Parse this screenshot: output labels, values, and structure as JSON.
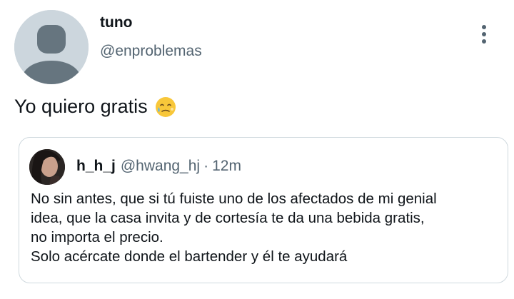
{
  "tweet": {
    "display_name": "tuno",
    "handle": "@enproblemas",
    "text": "Yo quiero gratis",
    "emoji": "face-holding-back-tears"
  },
  "quoted_tweet": {
    "display_name": "h_h_j",
    "handle": "@hwang_hj",
    "separator": "·",
    "time": "12m",
    "lines": [
      "No sin antes, que si tú fuiste uno de los afectados de mi genial",
      "idea, que la casa invita y de cortesía te da una bebida gratis,",
      "no importa el precio.",
      "Solo acércate donde el bartender y él te ayudará"
    ]
  },
  "colors": {
    "text_primary": "#0f1419",
    "text_secondary": "#536471",
    "border": "#cfd9de",
    "avatar_placeholder": "#ccd6dd"
  }
}
